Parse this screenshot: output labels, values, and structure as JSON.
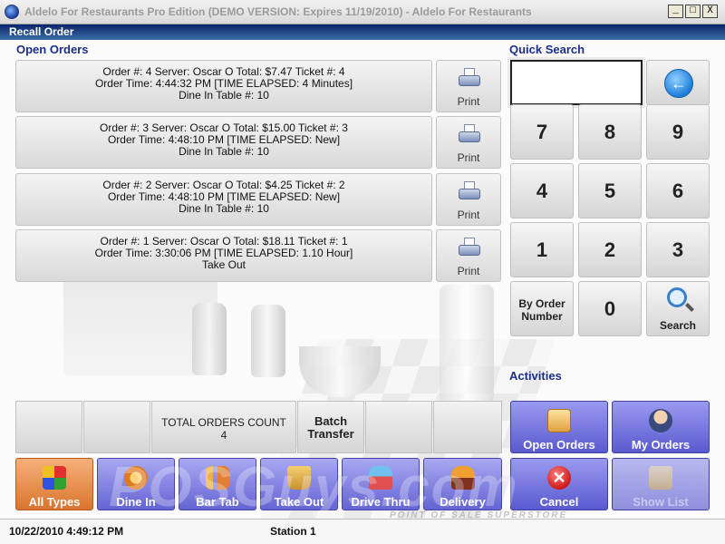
{
  "window": {
    "title": "Aldelo For Restaurants Pro Edition (DEMO VERSION: Expires 11/19/2010)  - Aldelo For Restaurants",
    "controls": [
      "_",
      "□",
      "X"
    ]
  },
  "dialog": {
    "title": "Recall Order"
  },
  "open_orders": {
    "heading": "Open Orders",
    "print_label": "Print",
    "orders": [
      {
        "line1": "Order #: 4   Server: Oscar O   Total: $7.47   Ticket #: 4",
        "line2": "Order Time: 4:44:32 PM    [TIME ELAPSED: 4 Minutes]",
        "line3": "Dine In    Table #: 10"
      },
      {
        "line1": "Order #: 3   Server: Oscar O   Total: $15.00   Ticket #: 3",
        "line2": "Order Time: 4:48:10 PM    [TIME ELAPSED: New]",
        "line3": "Dine In    Table #: 10"
      },
      {
        "line1": "Order #: 2   Server: Oscar O   Total: $4.25   Ticket #: 2",
        "line2": "Order Time: 4:48:10 PM    [TIME ELAPSED: New]",
        "line3": "Dine In    Table #: 10"
      },
      {
        "line1": "Order #: 1   Server: Oscar O   Total: $18.11   Ticket #: 1",
        "line2": "Order Time: 3:30:06 PM    [TIME ELAPSED: 1.10 Hour]",
        "line3": "Take Out"
      }
    ]
  },
  "quick_search": {
    "heading": "Quick Search",
    "value": "",
    "keys": [
      "7",
      "8",
      "9",
      "4",
      "5",
      "6",
      "1",
      "2",
      "3"
    ],
    "by_order_label": "By Order Number",
    "zero": "0",
    "search_label": "Search"
  },
  "summary": {
    "total_label": "TOTAL ORDERS COUNT",
    "total_value": "4",
    "batch_transfer": "Batch Transfer"
  },
  "activities": {
    "heading": "Activities",
    "open_orders": "Open Orders",
    "my_orders": "My Orders",
    "cancel": "Cancel",
    "show_list": "Show List"
  },
  "order_types": [
    "All Types",
    "Dine In",
    "Bar Tab",
    "Take Out",
    "Drive Thru",
    "Delivery"
  ],
  "watermark": {
    "text": "POSGuys.com",
    "tagline": "POINT OF SALE SUPERSTORE"
  },
  "status": {
    "datetime": "10/22/2010 4:49:12 PM",
    "station": "Station 1"
  },
  "colors": {
    "accent_blue": "#1c2e8a",
    "activity_purple": "#6464d4",
    "active_orange": "#d9742e"
  }
}
